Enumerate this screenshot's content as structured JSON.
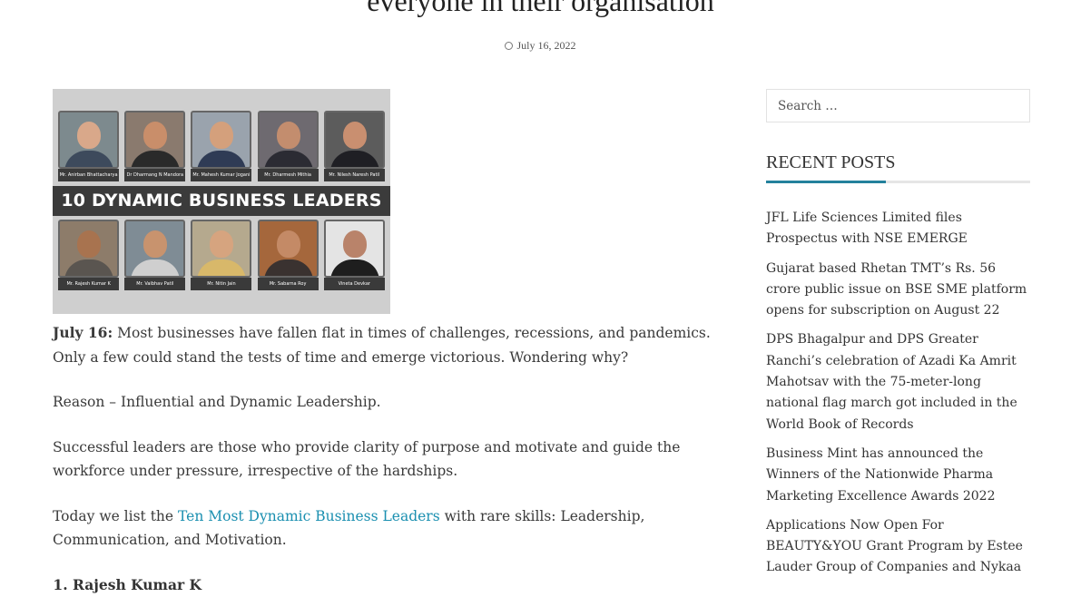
{
  "article": {
    "title": "everyone in their organisation",
    "date": "July 16, 2022",
    "image": {
      "banner": "10 DYNAMIC BUSINESS LEADERS",
      "top_row": [
        "Mr. Anirban Bhattacharya",
        "Dr Dharmang N Mandora",
        "Mr. Mahesh Kumar Jogani",
        "Mr. Dharmesh Mithia",
        "Mr. Nilesh Naresh Patil"
      ],
      "bottom_row": [
        "Mr. Rajesh Kumar K",
        "Mr. Vaibhav Patil",
        "Mr. Nitin Jain",
        "Mr. Sabarna Roy",
        "Vineta Devkar"
      ]
    },
    "p1_lead": "July 16:",
    "p1_rest": " Most businesses have fallen flat in times of challenges, recessions, and pandemics. Only a few could stand the tests of time and emerge victorious. Wondering why?",
    "p2": "Reason – Influential and Dynamic Leadership.",
    "p3": "Successful leaders are those who provide clarity of purpose and motivate and guide the workforce under pressure, irrespective of the hardships.",
    "p4_before": "Today we list the ",
    "p4_link": "Ten Most Dynamic Business Leaders",
    "p4_after": " with rare skills: Leadership, Communication, and Motivation.",
    "list": [
      "Rajesh Kumar K"
    ]
  },
  "sidebar": {
    "search_placeholder": "Search …",
    "recent_title": "RECENT POSTS",
    "recent_posts": [
      "JFL Life Sciences Limited files Prospectus with NSE EMERGE",
      "Gujarat based Rhetan TMT’s Rs. 56 crore public issue on BSE SME platform opens for subscription on August 22",
      "DPS Bhagalpur and DPS Greater Ranchi’s celebration of Azadi Ka Amrit Mahotsav with the 75-meter-long national flag march got included in the World Book of Records",
      "Business Mint has announced the Winners of the Nationwide Pharma Marketing Excellence Awards 2022",
      "Applications Now Open For BEAUTY&YOU Grant Program by Estee Lauder Group of Companies and Nykaa"
    ]
  },
  "colors": {
    "link": "#1a8fb0",
    "widget_accent": "#23819c",
    "banner_bg": "#3b3b3b"
  },
  "icons": {
    "date": "clock-icon"
  }
}
